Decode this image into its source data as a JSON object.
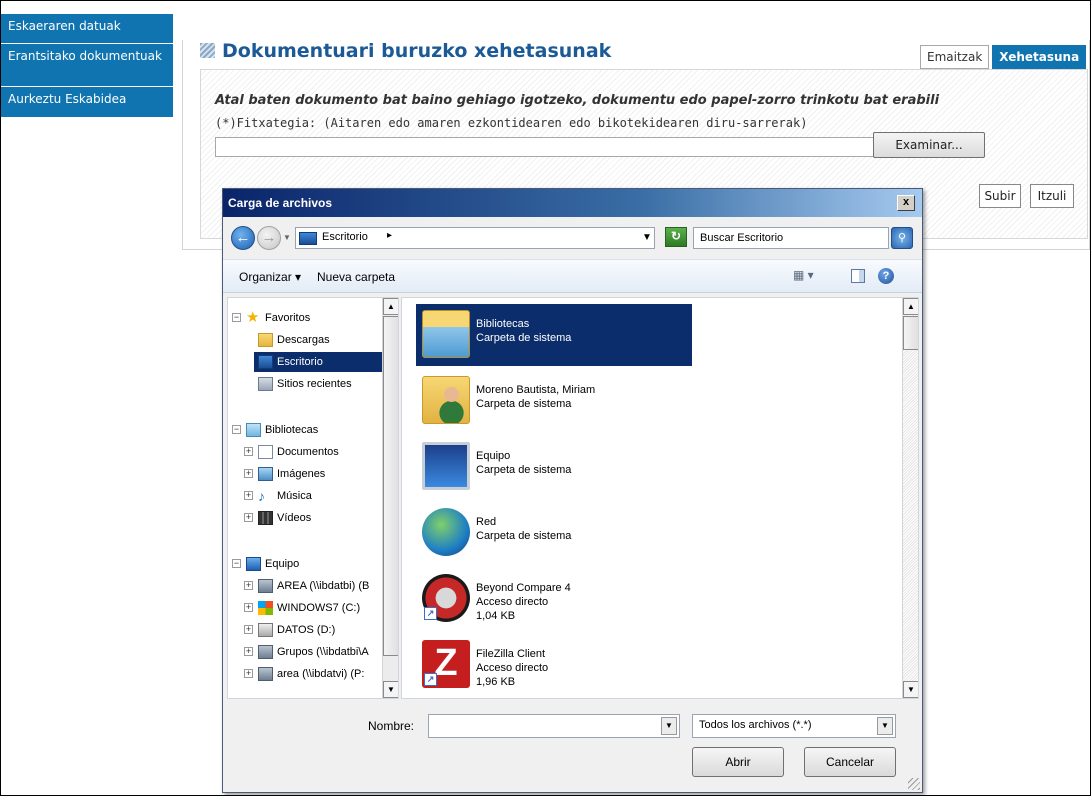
{
  "sidebar": {
    "items": [
      {
        "label": "Eskaeraren datuak"
      },
      {
        "label": "Erantsitako dokumentuak"
      },
      {
        "label": "Aurkeztu Eskabidea"
      }
    ]
  },
  "page": {
    "title": "Dokumentuari buruzko xehetasunak",
    "tabs": [
      {
        "label": "Emaitzak"
      },
      {
        "label": "Xehetasuna"
      }
    ],
    "instruction": "Atal baten dokumento bat baino gehiago igotzeko, dokumentu edo papel-zorro trinkotu bat erabili",
    "file_label": "(*)Fitxategia: (Aitaren edo amaren ezkontidearen edo bikotekidearen diru-sarrerak)",
    "file_value": "",
    "browse_label": "Examinar...",
    "submit_label": "Subir",
    "back_label": "Itzuli"
  },
  "dialog": {
    "title": "Carga de archivos",
    "close_label": "x",
    "address": "Escritorio",
    "search_placeholder": "Buscar Escritorio",
    "toolbar": {
      "organize": "Organizar",
      "new_folder": "Nueva carpeta"
    },
    "tree": [
      {
        "label": "Favoritos",
        "icon": "star-icon",
        "indent": 0,
        "expander": "−"
      },
      {
        "label": "Descargas",
        "icon": "downloads-icon",
        "indent": 1,
        "expander": ""
      },
      {
        "label": "Escritorio",
        "icon": "desktop-icon",
        "indent": 1,
        "expander": "",
        "selected": true
      },
      {
        "label": "Sitios recientes",
        "icon": "recent-places-icon",
        "indent": 1,
        "expander": ""
      },
      {
        "label": "Bibliotecas",
        "icon": "libraries-icon",
        "indent": 0,
        "expander": "−"
      },
      {
        "label": "Documentos",
        "icon": "documents-icon",
        "indent": 1,
        "expander": "+"
      },
      {
        "label": "Imágenes",
        "icon": "pictures-icon",
        "indent": 1,
        "expander": "+"
      },
      {
        "label": "Música",
        "icon": "music-icon",
        "indent": 1,
        "expander": "+"
      },
      {
        "label": "Vídeos",
        "icon": "videos-icon",
        "indent": 1,
        "expander": "+"
      },
      {
        "label": "Equipo",
        "icon": "computer-icon",
        "indent": 0,
        "expander": "−"
      },
      {
        "label": "AREA (\\\\ibdatbi) (B",
        "icon": "network-drive-icon",
        "indent": 1,
        "expander": "+"
      },
      {
        "label": "WINDOWS7 (C:)",
        "icon": "windows-drive-icon",
        "indent": 1,
        "expander": "+"
      },
      {
        "label": "DATOS (D:)",
        "icon": "drive-icon",
        "indent": 1,
        "expander": "+"
      },
      {
        "label": "Grupos (\\\\ibdatbi\\A",
        "icon": "network-drive-icon",
        "indent": 1,
        "expander": "+"
      },
      {
        "label": "area (\\\\ibdatvi) (P:",
        "icon": "network-drive-icon",
        "indent": 1,
        "expander": "+"
      }
    ],
    "files": [
      {
        "name": "Bibliotecas",
        "type": "Carpeta de sistema",
        "size": "",
        "icon": "libraries-folder-icon",
        "selected": true
      },
      {
        "name": "Moreno Bautista, Miriam",
        "type": "Carpeta de sistema",
        "size": "",
        "icon": "user-folder-icon"
      },
      {
        "name": "Equipo",
        "type": "Carpeta de sistema",
        "size": "",
        "icon": "computer-icon"
      },
      {
        "name": "Red",
        "type": "Carpeta de sistema",
        "size": "",
        "icon": "network-globe-icon"
      },
      {
        "name": "Beyond Compare 4",
        "type": "Acceso directo",
        "size": "1,04 KB",
        "icon": "beyond-compare-icon",
        "shortcut": true
      },
      {
        "name": "FileZilla Client",
        "type": "Acceso directo",
        "size": "1,96 KB",
        "icon": "filezilla-icon",
        "shortcut": true
      }
    ],
    "name_label": "Nombre:",
    "name_value": "",
    "filetype": "Todos los archivos (*.*)",
    "open_label": "Abrir",
    "cancel_label": "Cancelar"
  },
  "colors": {
    "nav_blue": "#0f74b0",
    "title_blue": "#1b5a96",
    "selection_navy": "#0c2d6b"
  }
}
